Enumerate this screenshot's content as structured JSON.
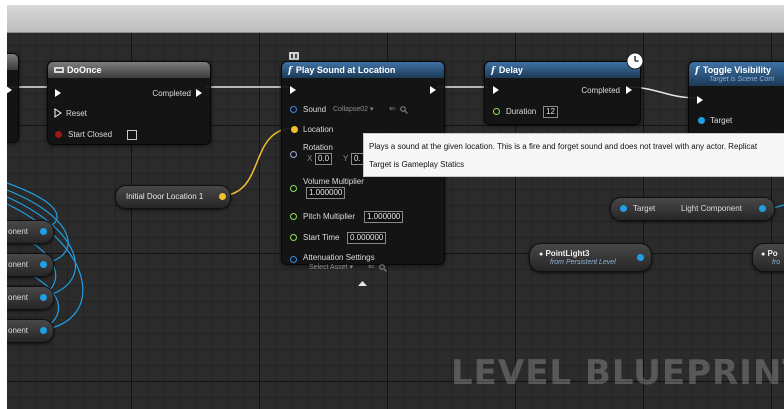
{
  "nodes": {
    "do_once": {
      "title": "DoOnce",
      "completed": "Completed",
      "reset": "Reset",
      "start_closed": "Start Closed"
    },
    "play_sound": {
      "title": "Play Sound at Location",
      "sound": "Sound",
      "sound_value": "Collapse02",
      "location": "Location",
      "rotation": "Rotation",
      "rot_x_label": "X",
      "rot_x": "0.0",
      "rot_y_label": "Y",
      "rot_y": "0.",
      "volume_multiplier": "Volume Multiplier",
      "volume_value": "1.000000",
      "pitch_multiplier": "Pitch Multiplier",
      "pitch_value": "1.000000",
      "start_time": "Start Time",
      "start_time_value": "0.000000",
      "attenuation_settings": "Attenuation Settings",
      "attenuation_value": "Select Asset"
    },
    "delay": {
      "title": "Delay",
      "completed": "Completed",
      "duration": "Duration",
      "duration_value": "12"
    },
    "toggle_visibility": {
      "title": "Toggle Visibility",
      "subtitle": "Target is Scene Com",
      "target": "Target"
    },
    "initial_door_location": {
      "label": "Initial Door Location 1"
    },
    "light_component": {
      "target": "Target",
      "output": "Light Component"
    },
    "point_light3": {
      "title": "PointLight3",
      "subtitle": "from Persistent Level"
    },
    "point_light_partial": {
      "title": "Po",
      "subtitle": "fro"
    },
    "left_components": [
      "onent",
      "onent",
      "onent",
      "onent"
    ]
  },
  "tooltip": {
    "line1": "Plays a sound at the given location. This is a fire and forget sound and does not travel with any actor. Replicat",
    "line2": "Target is Gameplay Statics"
  },
  "watermark": "LEVEL BLUEPRINT",
  "colors": {
    "exec": "#ffffff",
    "object_pin": "#1fa0e6",
    "vector_pin": "#f2c02c",
    "float_pin": "#8ee05a",
    "struct_pin": "#9aa9d6",
    "sound_pin": "#3b8be0",
    "function_header": "#2a5580",
    "macro_header": "#555555"
  },
  "icons": [
    "macro-node-icon",
    "function-icon",
    "clock-icon",
    "exec-pin-icon",
    "arrow-left-icon",
    "magnifier-icon",
    "expand-arrow-icon"
  ]
}
